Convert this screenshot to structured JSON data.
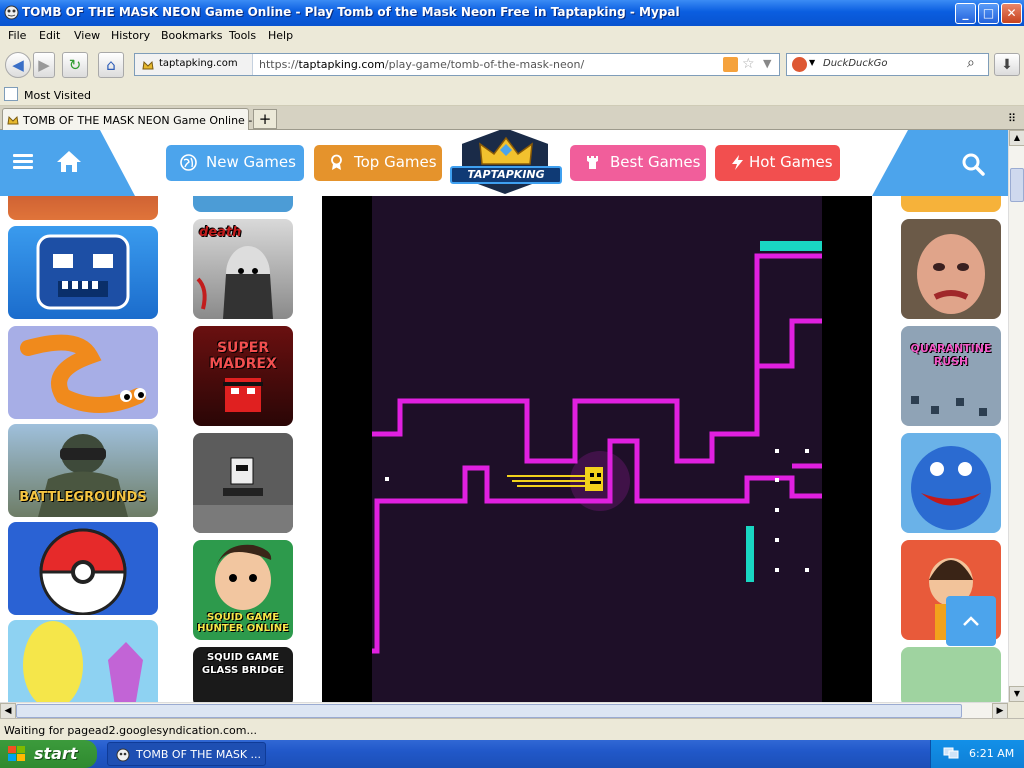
{
  "window": {
    "title": "TOMB OF THE MASK NEON Game Online - Play Tomb of the Mask Neon Free in Taptapking - Mypal",
    "controls": {
      "minimize": "_",
      "maximize": "□",
      "close": "✕"
    }
  },
  "menu": [
    "File",
    "Edit",
    "View",
    "History",
    "Bookmarks",
    "Tools",
    "Help"
  ],
  "nav": {
    "site_identity": "taptapking.com",
    "url_prefix": "https://",
    "url_domain": "taptapking.com",
    "url_path": "/play-game/tomb-of-the-mask-neon/",
    "search_placeholder": "DuckDuckGo"
  },
  "bookmarks": {
    "most_visited": "Most Visited"
  },
  "tab": {
    "label": "TOMB OF THE MASK NEON Game Online - Pl...",
    "new_tab": "+"
  },
  "site": {
    "logo_text": "TAPTAPKING",
    "buttons": {
      "new_games": "New Games",
      "top_games": "Top Games",
      "best_games": "Best Games",
      "hot_games": "Hot Games"
    },
    "colors": {
      "blue": "#4ca4ec",
      "orange": "#e5932c",
      "pink": "#f15e9b",
      "red": "#f24f4f",
      "neon": "#e020e0",
      "cyan": "#19d6c2"
    },
    "middle_thumbs": [
      "death",
      "SUPER MADREX",
      "SQUID GAME HUNTER ONLINE",
      "SQUID GAME GLASS BRIDGE"
    ],
    "left_thumbs": [
      "BATTLEGROUNDS"
    ],
    "right_thumbs": [
      "QUARANTINE RUSH"
    ]
  },
  "status": {
    "text": "Waiting for pagead2.googlesyndication.com..."
  },
  "taskbar": {
    "start": "start",
    "task_item": "TOMB OF THE MASK ...",
    "clock": "6:21 AM"
  }
}
